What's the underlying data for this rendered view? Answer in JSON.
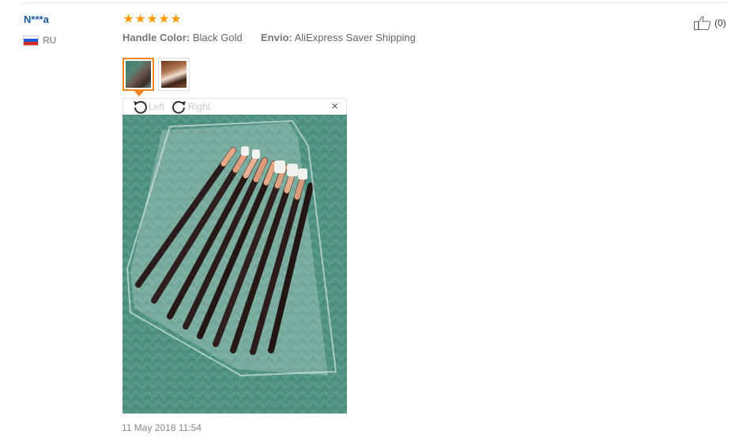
{
  "review": {
    "user_name": "N***a",
    "country_code": "RU",
    "flag_colors": [
      "#ffffff",
      "#1e5bd6",
      "#d52b1e"
    ],
    "rating": 5,
    "rating_max": 5,
    "star_glyph": "★",
    "star_color": "#ff9a00",
    "attributes": [
      {
        "label": "Handle Color:",
        "value": "Black Gold"
      },
      {
        "label": "Envio:",
        "value": "AliExpress Saver Shipping"
      }
    ],
    "helpful_count": "(0)",
    "date": "11 May 2018 11:54"
  },
  "viewer": {
    "rotate_left_label": "Left",
    "rotate_right_label": "Right",
    "close_glyph": "×",
    "selected_thumbnail": 1
  },
  "icons": {
    "like": "thumbs-up-icon",
    "rotate_left": "rotate-left-icon",
    "rotate_right": "rotate-right-icon",
    "close": "close-icon",
    "flag": "russia-flag-icon"
  },
  "colors": {
    "user_name": "#1c5aa6",
    "active_thumbnail_border": "#f5851f",
    "photo_background": "#4f9283"
  }
}
